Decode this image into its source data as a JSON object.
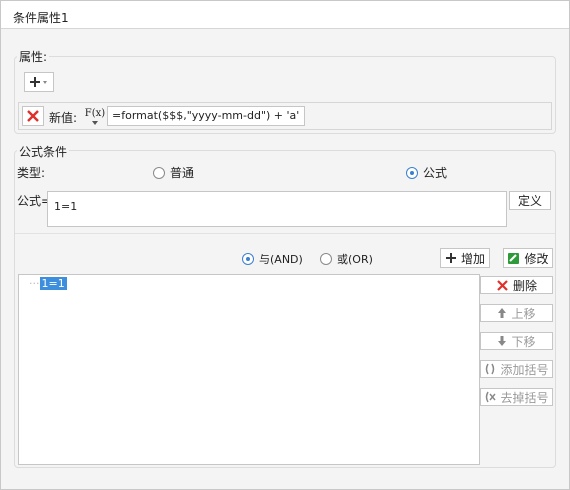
{
  "window": {
    "title": "条件属性1"
  },
  "properties": {
    "legend": "属性:",
    "new_value_label": "新值:",
    "formula_value": "=format($$$,\"yyyy-mm-dd\") + 'a'",
    "fx_label": "F(x)"
  },
  "conditions": {
    "legend": "公式条件",
    "type_label": "类型:",
    "type_options": [
      "普通",
      "公式"
    ],
    "type_selected": "公式",
    "formula_label": "公式=",
    "formula_text": "1=1",
    "define_button": "定义",
    "and_label": "与(AND)",
    "or_label": "或(OR)",
    "logic_selected": "与(AND)",
    "add_button": "增加",
    "modify_button": "修改",
    "tree_items": [
      "1=1"
    ],
    "side_buttons": {
      "delete": "删除",
      "move_up": "上移",
      "move_down": "下移",
      "add_bracket": "添加括号",
      "remove_bracket": "去掉括号"
    }
  },
  "colors": {
    "accent": "#3b7fd1",
    "delete_red": "#e0302a",
    "selection": "#3e8ede",
    "green": "#2e9b3a"
  }
}
